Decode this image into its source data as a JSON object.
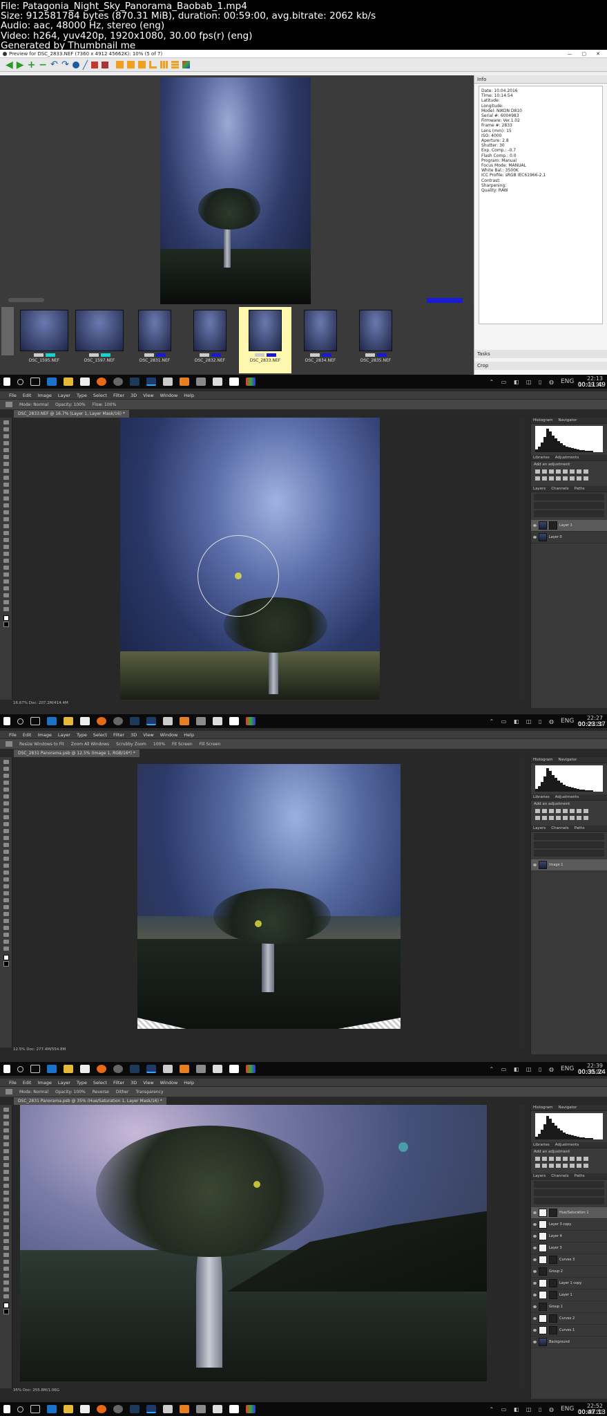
{
  "header": {
    "line1": "File: Patagonia_Night_Sky_Panorama_Baobab_1.mp4",
    "line2": "Size: 912581784 bytes (870.31 MiB), duration: 00:59:00, avg.bitrate: 2062 kb/s",
    "line3": "Audio: aac, 48000 Hz, stereo (eng)",
    "line4": "Video: h264, yuv420p, 1920x1080, 30.00 fps(r) (eng)",
    "line5": "Generated by Thumbnail me"
  },
  "preview": {
    "title": "Preview for DSC_2833.NEF (7360 x 4912 45662K): 10% (5 of 7)",
    "info_title": "Info",
    "info_lines": [
      "Date: 10.04.2016",
      "Time: 10:14:54",
      "Latitude:",
      "Longitude:",
      "Model: NIKON D810",
      "Serial #: 6004983",
      "Firmware: Ver.1.02",
      "Frame #: 2833",
      "Lens (mm): 15",
      "ISO: 4000",
      "Aperture: 2.8",
      "Shutter: 30",
      "Exp. Comp.: -0.7",
      "Flash Comp.: 0.0",
      "Program: Manual",
      "Focus Mode: MANUAL",
      "White Bal.: 3500K",
      "ICC Profile: sRGB IEC61966-2.1",
      "Contrast:",
      "Sharpening:",
      "Quality: RAW"
    ],
    "tasks_label": "Tasks",
    "crop_label": "Crop",
    "thumbs": [
      {
        "label": "DSC_1595.NEF",
        "selected": false
      },
      {
        "label": "DSC_1597.NEF",
        "selected": false
      },
      {
        "label": "DSC_2831.NEF",
        "selected": false
      },
      {
        "label": "DSC_2832.NEF",
        "selected": false
      },
      {
        "label": "DSC_2833.NEF",
        "selected": true
      },
      {
        "label": "DSC_2834.NEF",
        "selected": false
      },
      {
        "label": "DSC_2835.NEF",
        "selected": false
      }
    ]
  },
  "taskbars": [
    {
      "time": "22:13",
      "date": "10.09.20",
      "timestamp": "00:11:49",
      "lang": "ENG"
    },
    {
      "time": "22:27",
      "date": "10.09.20",
      "timestamp": "00:23:37",
      "lang": "ENG"
    },
    {
      "time": "22:39",
      "date": "10.09.20",
      "timestamp": "00:35:24",
      "lang": "ENG"
    },
    {
      "time": "22:52",
      "date": "10.09.20",
      "timestamp": "00:47:13",
      "lang": "ENG"
    }
  ],
  "ps": {
    "menu": [
      "File",
      "Edit",
      "Image",
      "Layer",
      "Type",
      "Select",
      "Filter",
      "3D",
      "View",
      "Window",
      "Help"
    ],
    "panel_tabs_top": [
      "Histogram",
      "Navigator"
    ],
    "panel_tabs_mid": [
      "Libraries",
      "Adjustments"
    ],
    "add_adjustment": "Add an adjustment",
    "panel_tabs_layers": [
      "Layers",
      "Channels",
      "Paths"
    ],
    "screens": [
      {
        "tab": "DSC_2833.NEF @ 16.7% (Layer 1, Layer Mask/16) *",
        "options": [
          "Mode: Normal",
          "Opacity: 100%",
          "Flow: 100%"
        ],
        "status": "16.67%   Doc: 207.2M/414.4M",
        "layers": [
          {
            "name": "Layer 1",
            "thumb": "img",
            "mask": true,
            "selected": true
          },
          {
            "name": "Layer 0",
            "thumb": "img",
            "mask": false,
            "selected": false
          }
        ]
      },
      {
        "tab": "DSC_2831 Panorama.psb @ 12.5% (Image 1, RGB/16*) *",
        "options": [
          "Resize Windows to Fit",
          "Zoom All Windows",
          "Scrubby Zoom",
          "100%",
          "Fit Screen",
          "Fill Screen"
        ],
        "status": "12.5%   Doc: 277.4M/554.8M",
        "layers": [
          {
            "name": "Image 1",
            "thumb": "img",
            "mask": false,
            "selected": true
          }
        ]
      },
      {
        "tab": "DSC_2831 Panorama.psb @ 35% (Hue/Saturation 1, Layer Mask/16) *",
        "options": [
          "Mode: Normal",
          "Opacity: 100%",
          "Reverse",
          "Dither",
          "Transparency"
        ],
        "status": "35%   Doc: 255.8M/1.06G",
        "layers": [
          {
            "name": "Hue/Saturation 1",
            "thumb": "white",
            "mask": true,
            "selected": true
          },
          {
            "name": "Layer 3 copy",
            "thumb": "white",
            "mask": false,
            "selected": false
          },
          {
            "name": "Layer 4",
            "thumb": "white",
            "mask": false,
            "selected": false
          },
          {
            "name": "Layer 3",
            "thumb": "white",
            "mask": false,
            "selected": false
          },
          {
            "name": "Curves 3",
            "thumb": "white",
            "mask": true,
            "selected": false
          },
          {
            "name": "Group 2",
            "thumb": "dark",
            "mask": false,
            "selected": false
          },
          {
            "name": "Layer 1 copy",
            "thumb": "white",
            "mask": true,
            "selected": false
          },
          {
            "name": "Layer 1",
            "thumb": "white",
            "mask": true,
            "selected": false
          },
          {
            "name": "Group 1",
            "thumb": "dark",
            "mask": false,
            "selected": false
          },
          {
            "name": "Curves 2",
            "thumb": "white",
            "mask": true,
            "selected": false
          },
          {
            "name": "Curves 1",
            "thumb": "white",
            "mask": true,
            "selected": false
          },
          {
            "name": "Background",
            "thumb": "img",
            "mask": false,
            "selected": false
          }
        ]
      }
    ]
  }
}
